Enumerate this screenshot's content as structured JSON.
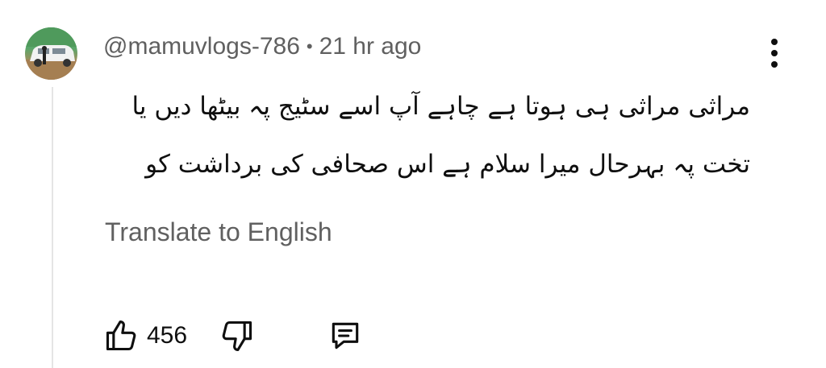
{
  "comment": {
    "author": "@mamuvlogs-786",
    "separator": "•",
    "time": "21 hr ago",
    "text_line1": "مراثی مراثی ہی ہوتا ہے چاہے آپ اسے سٹیج پہ بیٹھا دیں یا",
    "text_line2": "تخت پہ     بہرحال میرا سلام ہے اس صحافی کی برداشت کو",
    "translate_label": "Translate to English",
    "like_count": "456"
  },
  "icons": {
    "menu": "more-vert-icon",
    "like": "thumb-up-icon",
    "dislike": "thumb-down-icon",
    "reply": "comment-reply-icon"
  }
}
